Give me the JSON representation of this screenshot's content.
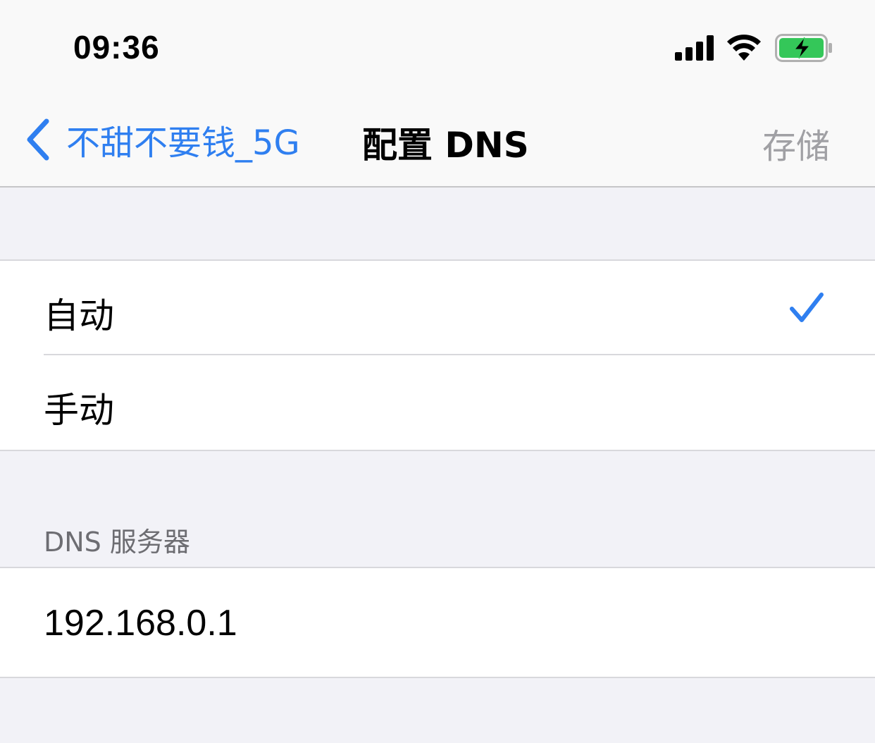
{
  "status_bar": {
    "time": "09:36",
    "icons": [
      "cellular-signal-icon",
      "wifi-icon",
      "battery-charging-icon"
    ],
    "battery_color": "#34c759"
  },
  "nav": {
    "back_label": "不甜不要钱_5G",
    "title": "配置 DNS",
    "save_label": "存储",
    "accent_color": "#2f7ff0"
  },
  "configure": {
    "options": [
      {
        "label": "自动",
        "selected": true
      },
      {
        "label": "手动",
        "selected": false
      }
    ]
  },
  "dns_servers": {
    "header": "DNS 服务器",
    "entries": [
      "192.168.0.1"
    ]
  }
}
